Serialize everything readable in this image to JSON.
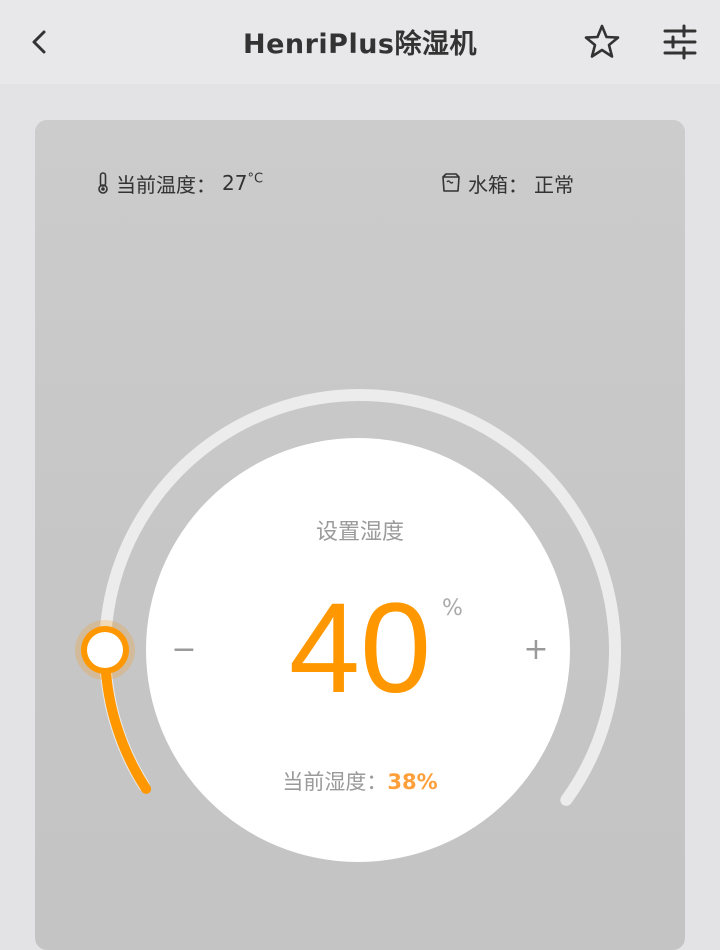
{
  "header": {
    "title": "HenriPlus除湿机",
    "back_icon": "chevron-left-icon",
    "favorite_icon": "star-outline-icon",
    "settings_icon": "sliders-icon"
  },
  "status": {
    "temperature_label": "当前温度：",
    "temperature_value": "27",
    "temperature_unit": "°C",
    "tank_label": "水箱：",
    "tank_value": "正常"
  },
  "dial": {
    "title": "设置湿度",
    "set_value": "40",
    "unit": "%",
    "set_fraction": 0.4,
    "minus_label": "−",
    "plus_label": "+",
    "current_label": "当前湿度：",
    "current_value": "38%"
  },
  "colors": {
    "accent": "#ff9800",
    "track": "#ececec",
    "text": "#333333",
    "muted": "#9a9a9a"
  }
}
